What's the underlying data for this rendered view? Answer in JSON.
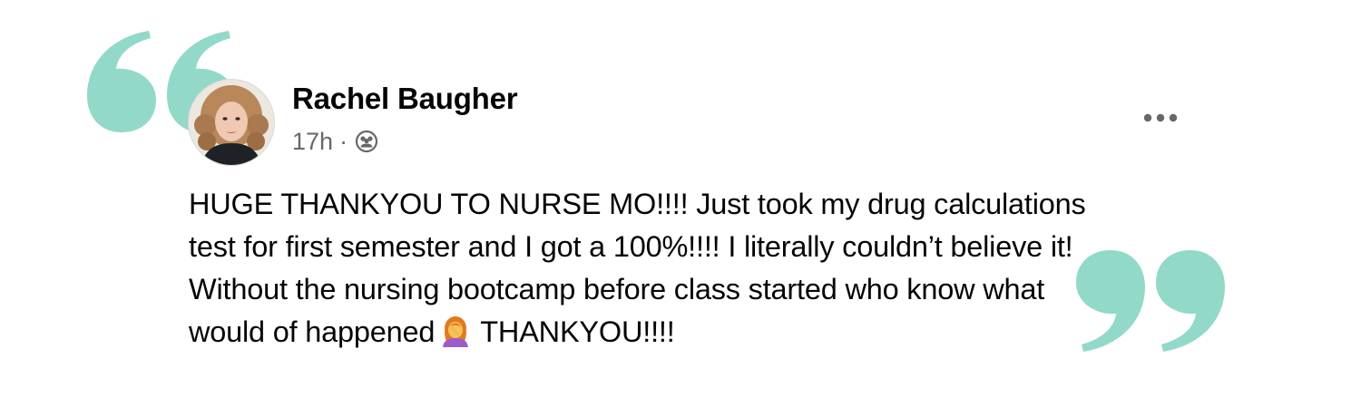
{
  "colors": {
    "quote_mark": "#7fd2c0",
    "text": "#050505",
    "secondary_text": "#65676b",
    "icon_gray": "#65676b"
  },
  "post": {
    "author_name": "Rachel Baugher",
    "timestamp": "17h",
    "separator": "·",
    "audience_icon": "friends-icon",
    "more_icon": "more-options-icon",
    "body_lines": [
      "HUGE THANKYOU TO NURSE MO!!!! Just took my drug calculations",
      "test for first semester and I got a 100%!!!! I literally couldn’t believe it!",
      "Without the nursing bootcamp before class started who know what",
      "would of happened",
      "THANKYOU!!!!"
    ],
    "emoji": "woman-facepalming-emoji"
  }
}
